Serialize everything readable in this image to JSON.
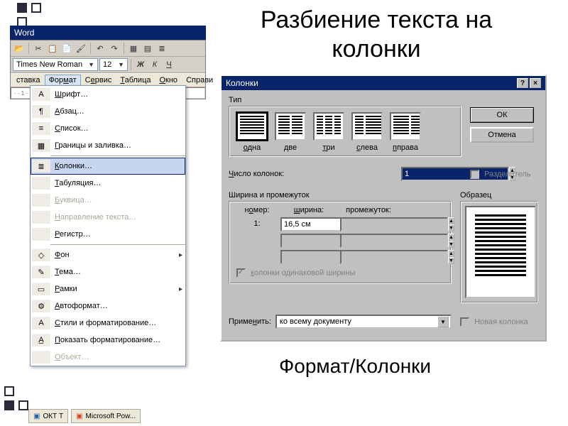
{
  "slide": {
    "title": "Разбиение текста на колонки",
    "caption": "Формат/Колонки"
  },
  "word": {
    "title": "Word",
    "font": "Times New Roman",
    "size": "12",
    "menus": [
      "ставка",
      "Формат",
      "Сервис",
      "Таблица",
      "Окно",
      "Справи"
    ],
    "dropdown": [
      {
        "icon": "A",
        "label": "Шрифт…",
        "dis": false
      },
      {
        "icon": "¶",
        "label": "Абзац…",
        "dis": false
      },
      {
        "icon": "≡",
        "label": "Список…",
        "dis": false
      },
      {
        "icon": "▦",
        "label": "Границы и заливка…",
        "dis": false
      },
      {
        "sep": true
      },
      {
        "icon": "≣",
        "label": "Колонки…",
        "sel": true
      },
      {
        "icon": "",
        "label": "Табуляция…",
        "dis": false
      },
      {
        "icon": "",
        "label": "Буквица…",
        "dis": true
      },
      {
        "icon": "",
        "label": "Направление текста…",
        "dis": true
      },
      {
        "icon": "",
        "label": "Регистр…",
        "dis": false
      },
      {
        "sep": true
      },
      {
        "icon": "◇",
        "label": "Фон",
        "sub": true
      },
      {
        "icon": "✎",
        "label": "Тема…",
        "dis": false
      },
      {
        "icon": "▭",
        "label": "Рамки",
        "sub": true
      },
      {
        "icon": "⚙",
        "label": "Автоформат…",
        "dis": false
      },
      {
        "icon": "A",
        "label": "Стили и форматирование…",
        "dis": false
      },
      {
        "icon": "A̲",
        "label": "Показать форматирование…",
        "dis": false
      },
      {
        "icon": "",
        "label": "Объект…",
        "dis": true
      }
    ]
  },
  "dialog": {
    "title": "Колонки",
    "ok": "ОК",
    "cancel": "Отмена",
    "typeLabel": "Тип",
    "presets": [
      {
        "name": "одна",
        "cols": 1,
        "sel": true,
        "key": "о"
      },
      {
        "name": "две",
        "cols": 2,
        "key": "д"
      },
      {
        "name": "три",
        "cols": 3,
        "key": "т"
      },
      {
        "name": "слева",
        "cols": 2,
        "narrowLeft": true,
        "key": "с"
      },
      {
        "name": "справа",
        "cols": 2,
        "narrowRight": true,
        "key": "п"
      }
    ],
    "numLabel": "Число колонок:",
    "numVal": "1",
    "dividerLabel": "Разделитель",
    "whLabel": "Ширина и промежуток",
    "colHdr": {
      "num": "номер:",
      "w": "ширина:",
      "g": "промежуток:"
    },
    "rows": [
      {
        "num": "1:",
        "w": "16,5 см",
        "g": ""
      },
      {
        "num": "",
        "w": "",
        "g": ""
      },
      {
        "num": "",
        "w": "",
        "g": ""
      }
    ],
    "equalLabel": "колонки одинаковой ширины",
    "sampleLabel": "Образец",
    "applyLabel": "Применить:",
    "applyVal": "ко всему документу",
    "newColLabel": "Новая колонка"
  },
  "taskbar": {
    "a": "ОКТ Т",
    "b": "Microsoft Pow..."
  }
}
